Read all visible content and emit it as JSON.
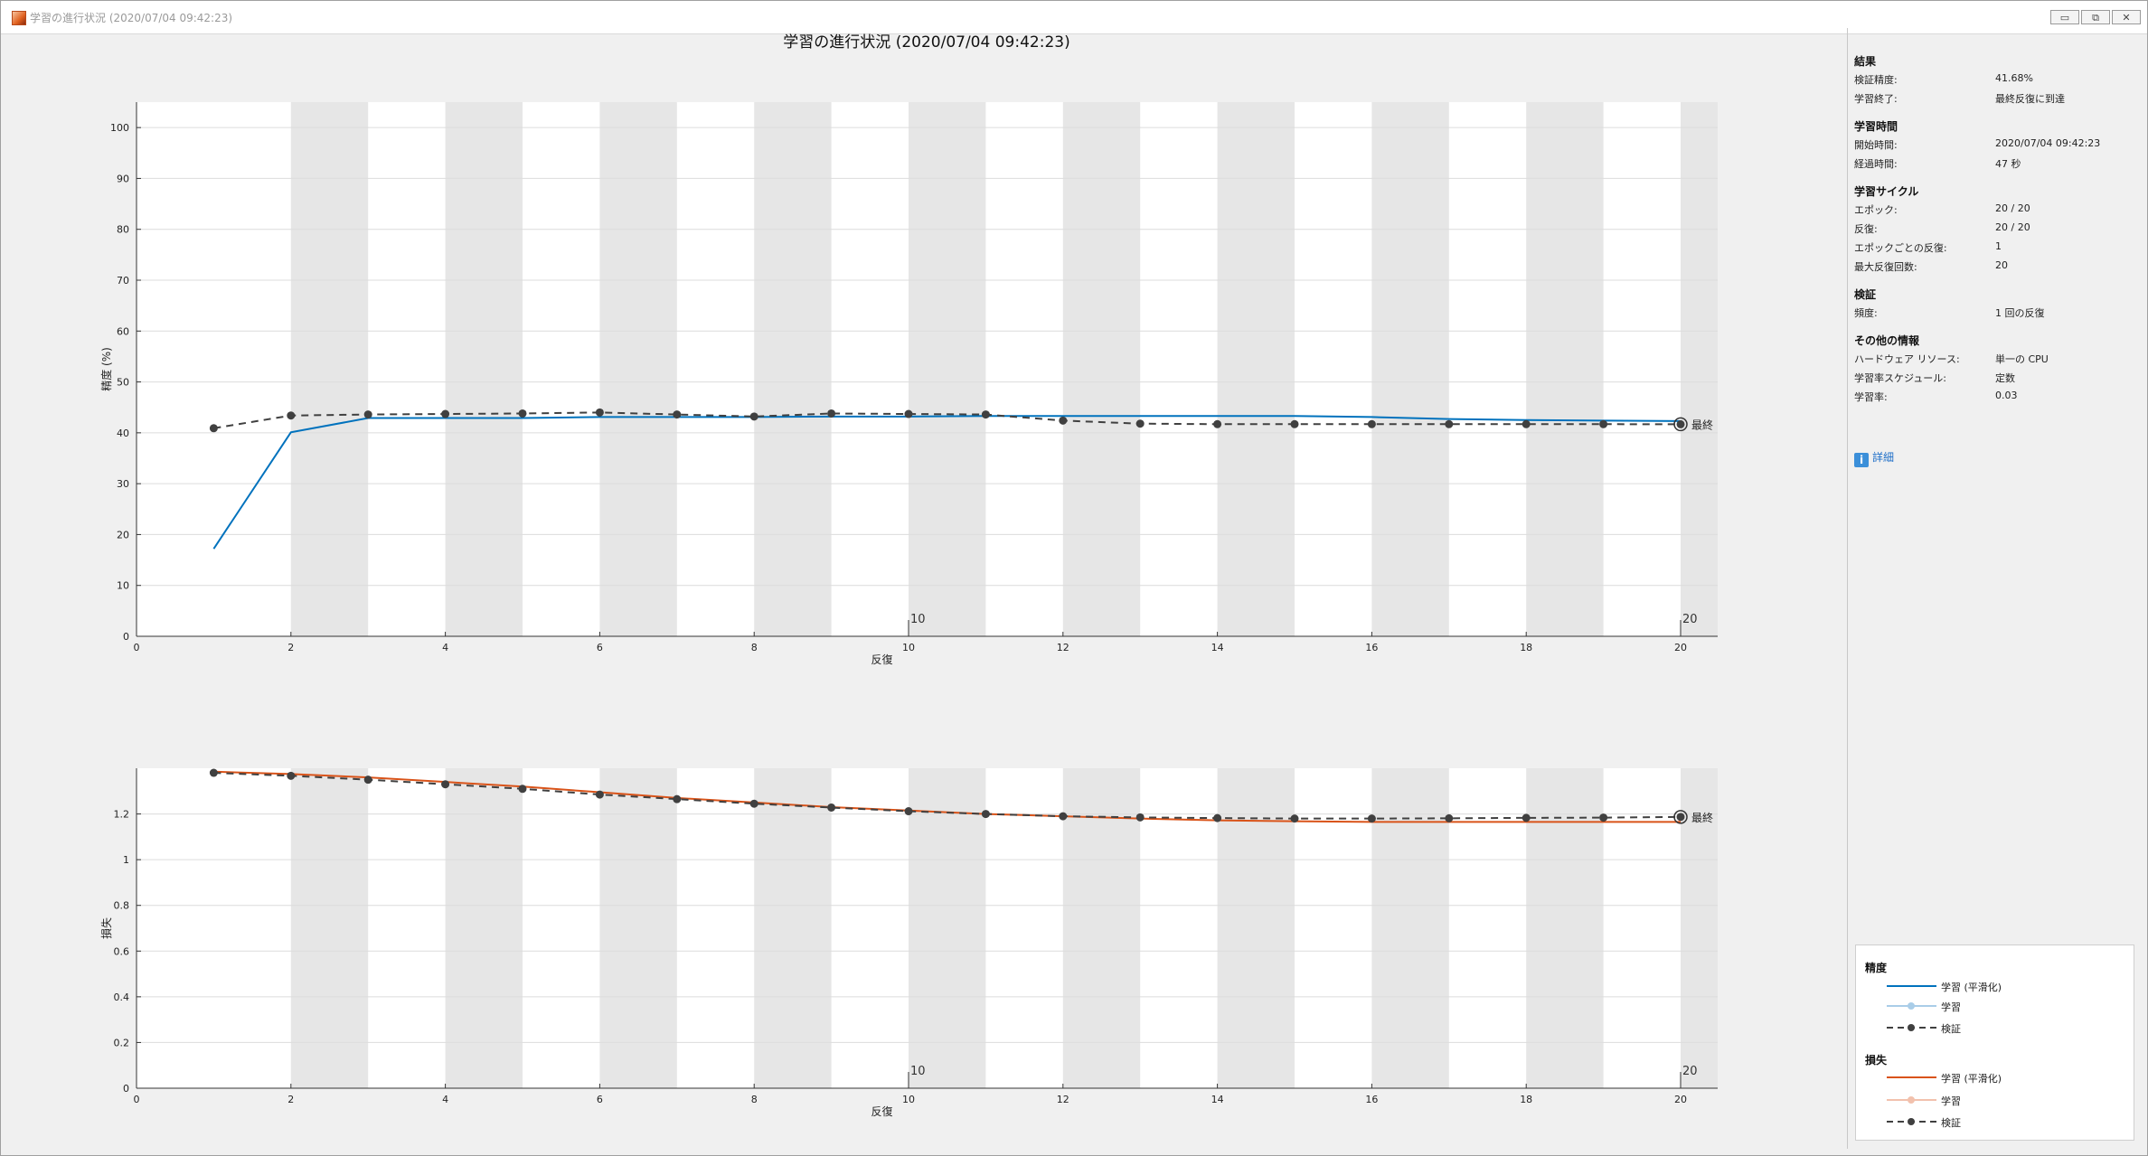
{
  "window": {
    "title": "学習の進行状況 (2020/07/04 09:42:23)",
    "buttons": [
      "▭",
      "⧉",
      "✕"
    ]
  },
  "plot_title": "学習の進行状況 (2020/07/04 09:42:23)",
  "final_label": "最終",
  "chart_data": [
    {
      "type": "line",
      "xlabel": "反復",
      "ylabel": "精度 (%)",
      "xlim": [
        0,
        20
      ],
      "ylim": [
        0,
        105
      ],
      "xticks": [
        0,
        2,
        4,
        6,
        8,
        10,
        12,
        14,
        16,
        18,
        20
      ],
      "yticks": [
        0,
        10,
        20,
        30,
        40,
        50,
        60,
        70,
        80,
        90,
        100
      ],
      "epoch_labels": [
        "10",
        "20"
      ],
      "series": [
        {
          "name": "学習 (平滑化)",
          "color": "#0072bd",
          "style": "solid",
          "x": [
            1,
            2,
            3,
            4,
            5,
            6,
            7,
            8,
            9,
            10,
            11,
            12,
            13,
            14,
            15,
            16,
            17,
            18,
            19,
            20
          ],
          "values": [
            17.2,
            40.1,
            42.9,
            42.9,
            42.9,
            43.1,
            43.1,
            43.1,
            43.2,
            43.2,
            43.3,
            43.3,
            43.3,
            43.3,
            43.3,
            43.1,
            42.7,
            42.5,
            42.4,
            42.3
          ]
        },
        {
          "name": "検証",
          "color": "#404040",
          "style": "dashed",
          "x": [
            1,
            2,
            3,
            4,
            5,
            6,
            7,
            8,
            9,
            10,
            11,
            12,
            13,
            14,
            15,
            16,
            17,
            18,
            19,
            20
          ],
          "values": [
            40.9,
            43.4,
            43.6,
            43.7,
            43.8,
            44.0,
            43.6,
            43.2,
            43.8,
            43.7,
            43.6,
            42.4,
            41.8,
            41.7,
            41.7,
            41.7,
            41.7,
            41.7,
            41.7,
            41.68
          ]
        }
      ]
    },
    {
      "type": "line",
      "xlabel": "反復",
      "ylabel": "損失",
      "xlim": [
        0,
        20
      ],
      "ylim": [
        0,
        1.4
      ],
      "xticks": [
        0,
        2,
        4,
        6,
        8,
        10,
        12,
        14,
        16,
        18,
        20
      ],
      "yticks": [
        0,
        0.2,
        0.4,
        0.6,
        0.8,
        1,
        1.2
      ],
      "epoch_labels": [
        "10",
        "20"
      ],
      "series": [
        {
          "name": "学習 (平滑化)",
          "color": "#d95319",
          "style": "solid",
          "x": [
            1,
            2,
            3,
            4,
            5,
            6,
            7,
            8,
            9,
            10,
            11,
            12,
            13,
            14,
            15,
            16,
            17,
            18,
            19,
            20
          ],
          "values": [
            1.385,
            1.375,
            1.36,
            1.34,
            1.32,
            1.295,
            1.27,
            1.25,
            1.23,
            1.215,
            1.2,
            1.19,
            1.18,
            1.172,
            1.168,
            1.165,
            1.165,
            1.165,
            1.165,
            1.165
          ]
        },
        {
          "name": "検証",
          "color": "#404040",
          "style": "dashed",
          "x": [
            1,
            2,
            3,
            4,
            5,
            6,
            7,
            8,
            9,
            10,
            11,
            12,
            13,
            14,
            15,
            16,
            17,
            18,
            19,
            20
          ],
          "values": [
            1.38,
            1.367,
            1.35,
            1.33,
            1.31,
            1.285,
            1.265,
            1.245,
            1.228,
            1.212,
            1.2,
            1.19,
            1.185,
            1.182,
            1.18,
            1.18,
            1.181,
            1.183,
            1.184,
            1.187
          ]
        }
      ]
    }
  ],
  "panel": {
    "sections": [
      {
        "title": "結果",
        "rows": [
          {
            "label": "検証精度:",
            "value": "41.68%"
          },
          {
            "label": "学習終了:",
            "value": "最終反復に到達"
          }
        ]
      },
      {
        "title": "学習時間",
        "rows": [
          {
            "label": "開始時間:",
            "value": "2020/07/04 09:42:23"
          },
          {
            "label": "経過時間:",
            "value": "47 秒"
          }
        ]
      },
      {
        "title": "学習サイクル",
        "rows": [
          {
            "label": "エポック:",
            "value": "20 / 20"
          },
          {
            "label": "反復:",
            "value": "20 / 20"
          },
          {
            "label": "エポックごとの反復:",
            "value": "1"
          },
          {
            "label": "最大反復回数:",
            "value": "20"
          }
        ]
      },
      {
        "title": "検証",
        "rows": [
          {
            "label": "頻度:",
            "value": "1 回の反復"
          }
        ]
      },
      {
        "title": "その他の情報",
        "rows": [
          {
            "label": "ハードウェア リソース:",
            "value": "単一の CPU"
          },
          {
            "label": "学習率スケジュール:",
            "value": "定数"
          },
          {
            "label": "学習率:",
            "value": "0.03"
          }
        ]
      }
    ],
    "details_link": "詳細"
  },
  "legend": {
    "accuracy": {
      "title": "精度",
      "items": [
        "学習 (平滑化)",
        "学習",
        "検証"
      ]
    },
    "loss": {
      "title": "損失",
      "items": [
        "学習 (平滑化)",
        "学習",
        "検証"
      ]
    }
  },
  "colors": {
    "accuracy_train": "#0072bd",
    "accuracy_train_raw": "#a9cde8",
    "loss_train": "#d95319",
    "loss_train_raw": "#f2c1ad",
    "validation": "#404040",
    "epoch_shade": "#e6e6e6"
  }
}
